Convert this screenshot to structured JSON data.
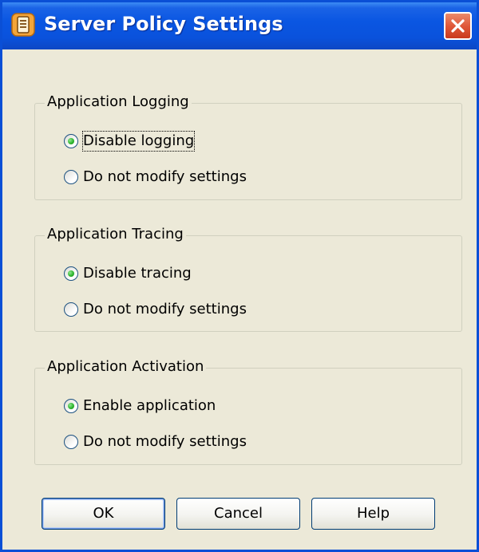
{
  "window": {
    "title": "Server Policy Settings"
  },
  "groups": [
    {
      "legend": "Application Logging",
      "options": [
        {
          "label": "Disable logging",
          "checked": true
        },
        {
          "label": "Do not modify settings",
          "checked": false
        }
      ]
    },
    {
      "legend": "Application Tracing",
      "options": [
        {
          "label": "Disable tracing",
          "checked": true
        },
        {
          "label": "Do not modify settings",
          "checked": false
        }
      ]
    },
    {
      "legend": "Application Activation",
      "options": [
        {
          "label": "Enable application",
          "checked": true
        },
        {
          "label": "Do not modify settings",
          "checked": false
        }
      ]
    }
  ],
  "buttons": {
    "ok": "OK",
    "cancel": "Cancel",
    "help": "Help"
  },
  "icons": {
    "app": "server-policy-icon",
    "close": "close-icon"
  },
  "colors": {
    "titlebar": "#0a56e2",
    "dialog_background": "#ece9d8",
    "close_button": "#e0583a"
  }
}
